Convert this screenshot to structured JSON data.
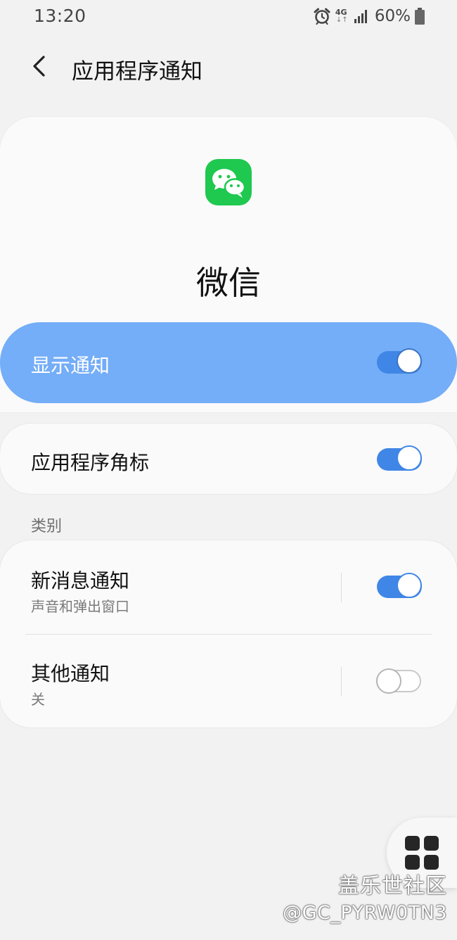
{
  "status_bar": {
    "time": "13:20",
    "network": "4G",
    "network_arrows": "↓↑",
    "battery": "60%",
    "icons": [
      "alarm-icon",
      "network-4g-icon",
      "signal-icon",
      "battery-icon"
    ]
  },
  "header": {
    "back_icon": "chevron-left-icon",
    "title": "应用程序通知"
  },
  "app": {
    "name": "微信",
    "icon": "wechat-icon",
    "brand_color": "#1fc84f"
  },
  "show_notifications": {
    "label": "显示通知",
    "enabled": true
  },
  "app_badge": {
    "label": "应用程序角标",
    "enabled": true
  },
  "categories": {
    "section_label": "类别",
    "items": [
      {
        "title": "新消息通知",
        "subtitle": "声音和弹出窗口",
        "enabled": true
      },
      {
        "title": "其他通知",
        "subtitle": "关",
        "enabled": false
      }
    ]
  },
  "floating_button": {
    "icon": "grid-menu-icon"
  },
  "watermark": {
    "brand": "盖乐世社区",
    "user": "@GC_PYRW0TN3"
  },
  "colors": {
    "accent": "#3f86e6",
    "highlight_row": "#74adf8",
    "background": "#f2f2f2",
    "card": "#fafafa"
  }
}
